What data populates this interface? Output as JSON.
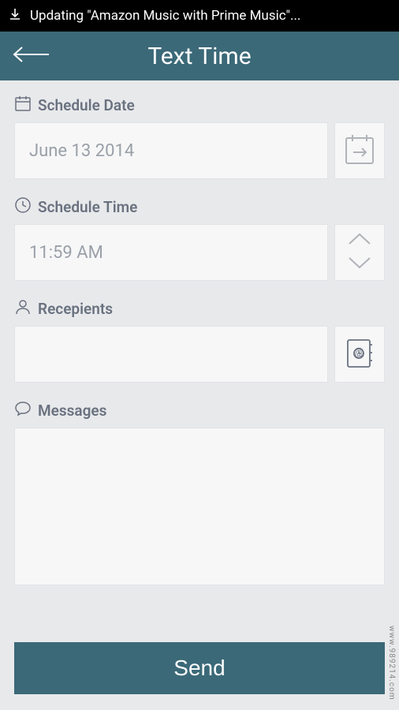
{
  "notification": {
    "text": "Updating \"Amazon Music with Prime Music\"..."
  },
  "header": {
    "title": "Text Time"
  },
  "schedule_date": {
    "label": "Schedule Date",
    "value": "June 13 2014"
  },
  "schedule_time": {
    "label": "Schedule Time",
    "value": "11:59 AM"
  },
  "recipients": {
    "label": "Recepients",
    "value": ""
  },
  "messages": {
    "label": "Messages",
    "value": ""
  },
  "send_button": {
    "label": "Send"
  },
  "watermark": "www.989214.com",
  "colors": {
    "header_bg": "#3b6978",
    "page_bg": "#e8e9eb",
    "field_bg": "#f7f7f8",
    "label_color": "#6a7280",
    "placeholder_color": "#9aa0a8"
  }
}
